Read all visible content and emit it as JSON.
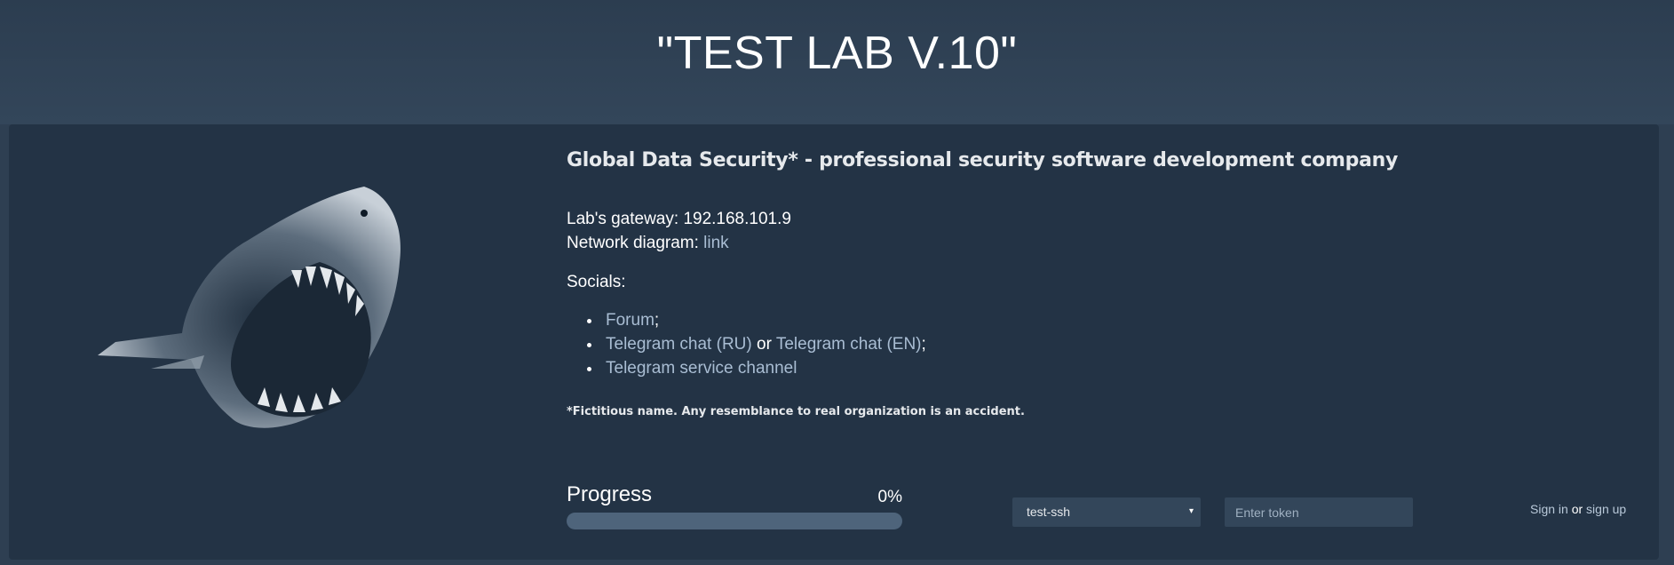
{
  "header": {
    "title": "\"TEST LAB V.10\""
  },
  "main": {
    "company_heading": "Global Data Security* - professional security software development company",
    "gateway_label": "Lab's gateway:",
    "gateway_value": "192.168.101.9",
    "diagram_label": "Network diagram:",
    "diagram_link": "link",
    "socials_label": "Socials:",
    "socials": {
      "forum": "Forum",
      "forum_suffix": ";",
      "telegram_ru": "Telegram chat (RU)",
      "or": "or",
      "telegram_en": "Telegram chat (EN)",
      "telegram_en_suffix": ";",
      "service_channel": "Telegram service channel"
    },
    "footnote": "*Fictitious name. Any resemblance to real organization is an accident."
  },
  "progress": {
    "label": "Progress",
    "value_text": "0%",
    "fraction": 0
  },
  "lab_select": {
    "selected": "test-ssh"
  },
  "token": {
    "placeholder": "Enter token"
  },
  "auth": {
    "sign_in": "Sign in",
    "or": "or",
    "sign_up": "sign up"
  },
  "colors": {
    "background": "#2e3f52",
    "panel": "#233345",
    "link": "#a9bdd3",
    "progress_track": "#4e647b"
  },
  "icons": {
    "shark": "shark-image",
    "caret": "caret-down-icon"
  }
}
